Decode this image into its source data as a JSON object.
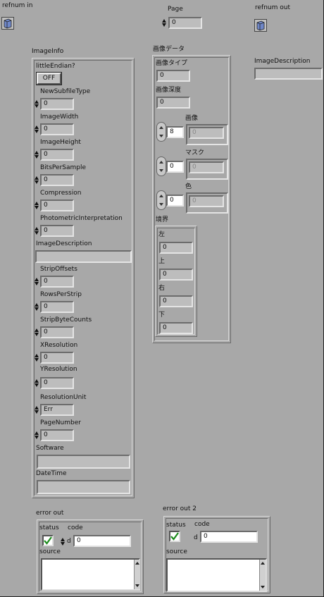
{
  "top": {
    "refnum_in_label": "refnum in",
    "page_label": "Page",
    "page_value": "0",
    "refnum_out_label": "refnum out",
    "image_description_label": "ImageDescription",
    "image_description_value": ""
  },
  "image_info": {
    "title": "ImageInfo",
    "little_endian_label": "littleEndian?",
    "little_endian_button": "OFF",
    "fields": [
      {
        "label": "NewSubfileType",
        "value": "0"
      },
      {
        "label": "ImageWidth",
        "value": "0"
      },
      {
        "label": "ImageHeight",
        "value": "0"
      },
      {
        "label": "BitsPerSample",
        "value": "0"
      },
      {
        "label": "Compression",
        "value": "0"
      },
      {
        "label": "PhotometricInterpretation",
        "value": "0"
      }
    ],
    "image_description_label": "ImageDescription",
    "image_description_value": "",
    "fields2": [
      {
        "label": "StripOffsets",
        "value": "0"
      },
      {
        "label": "RowsPerStrip",
        "value": "0"
      },
      {
        "label": "StripByteCounts",
        "value": "0"
      },
      {
        "label": "XResolution",
        "value": "0"
      },
      {
        "label": "YResolution",
        "value": "0"
      }
    ],
    "resolution_unit_label": "ResolutionUnit",
    "resolution_unit_value": "Err",
    "page_number_label": "PageNumber",
    "page_number_value": "0",
    "software_label": "Software",
    "software_value": "",
    "datetime_label": "DateTime",
    "datetime_value": ""
  },
  "image_data": {
    "title": "画像データ",
    "image_type_label": "画像タイプ",
    "image_type_value": "0",
    "image_depth_label": "画像深度",
    "image_depth_value": "0",
    "image_array_label": "画像",
    "image_index": "8",
    "image_elem": "0",
    "mask_array_label": "マスク",
    "mask_index": "0",
    "mask_elem": "0",
    "color_array_label": "色",
    "color_index": "0",
    "color_elem": "0",
    "bounds_label": "境界",
    "left_label": "左",
    "left_value": "0",
    "top_label": "上",
    "top_value": "0",
    "right_label": "右",
    "right_value": "0",
    "bottom_label": "下",
    "bottom_value": "0"
  },
  "error_out": {
    "title": "error out",
    "status_label": "status",
    "code_label": "code",
    "code_prefix": "d",
    "code_value": "0",
    "source_label": "source",
    "source_value": ""
  },
  "error_out_2": {
    "title": "error out 2",
    "status_label": "status",
    "code_label": "code",
    "code_prefix": "d",
    "code_value": "0",
    "source_label": "source",
    "source_value": ""
  },
  "colors": {
    "panel_bg": "#a8a8a8",
    "field_bg": "#bdbdbd",
    "checkbox_check": "#1a8a1a"
  }
}
